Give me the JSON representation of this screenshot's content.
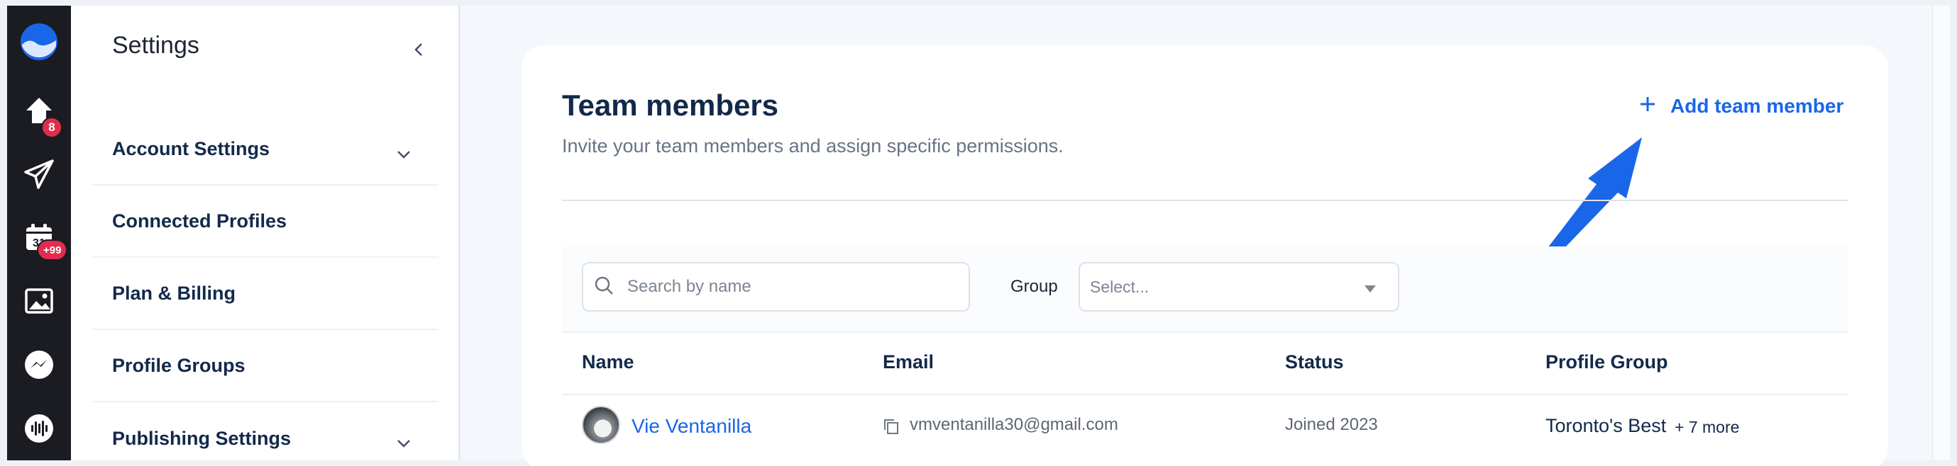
{
  "colors": {
    "accent": "#1a66e8",
    "badge": "#e02d4d",
    "rail_bg": "#1a1c22",
    "heading": "#13294b"
  },
  "rail": {
    "items": [
      {
        "icon": "app-logo-icon"
      },
      {
        "icon": "home-icon",
        "badge": "8"
      },
      {
        "icon": "paper-plane-icon"
      },
      {
        "icon": "calendar-icon",
        "badge": "+99"
      },
      {
        "icon": "image-icon"
      },
      {
        "icon": "messenger-icon"
      },
      {
        "icon": "audio-wave-icon"
      }
    ]
  },
  "sidebar": {
    "title": "Settings",
    "items": [
      {
        "label": "Account Settings",
        "expandable": true
      },
      {
        "label": "Connected Profiles",
        "expandable": false
      },
      {
        "label": "Plan & Billing",
        "expandable": false
      },
      {
        "label": "Profile Groups",
        "expandable": false
      },
      {
        "label": "Publishing Settings",
        "expandable": true
      }
    ]
  },
  "main": {
    "title": "Team members",
    "subtitle": "Invite your team members and assign specific permissions.",
    "add_button_label": "Add team member",
    "search": {
      "placeholder": "Search by name",
      "value": ""
    },
    "group_filter": {
      "label": "Group",
      "placeholder": "Select..."
    },
    "table": {
      "columns": [
        "Name",
        "Email",
        "Status",
        "Profile Group"
      ],
      "rows": [
        {
          "name": "Vie Ventanilla",
          "email": "vmventanilla30@gmail.com",
          "status": "Joined 2023",
          "profile_group": "Toronto's Best",
          "profile_group_more": "+ 7 more"
        }
      ]
    }
  }
}
